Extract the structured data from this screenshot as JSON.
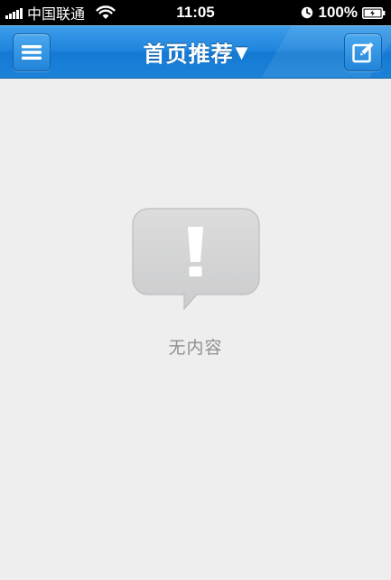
{
  "status_bar": {
    "carrier": "中国联通",
    "time": "11:05",
    "battery_percent": "100%",
    "signal_icon": "signal-bars-icon",
    "wifi_icon": "wifi-icon",
    "clock_icon": "alarm-clock-icon",
    "battery_icon": "battery-charging-icon"
  },
  "nav_bar": {
    "title": "首页推荐",
    "caret": "▼",
    "menu_icon": "hamburger-menu-icon",
    "compose_icon": "compose-edit-icon",
    "colors": {
      "bar": "#1f84dc",
      "button": "#2284d8"
    }
  },
  "empty_state": {
    "icon": "exclamation-bubble-icon",
    "message": "无内容",
    "colors": {
      "bubble": "#d2d3d5",
      "text": "#8f8f8f"
    }
  }
}
